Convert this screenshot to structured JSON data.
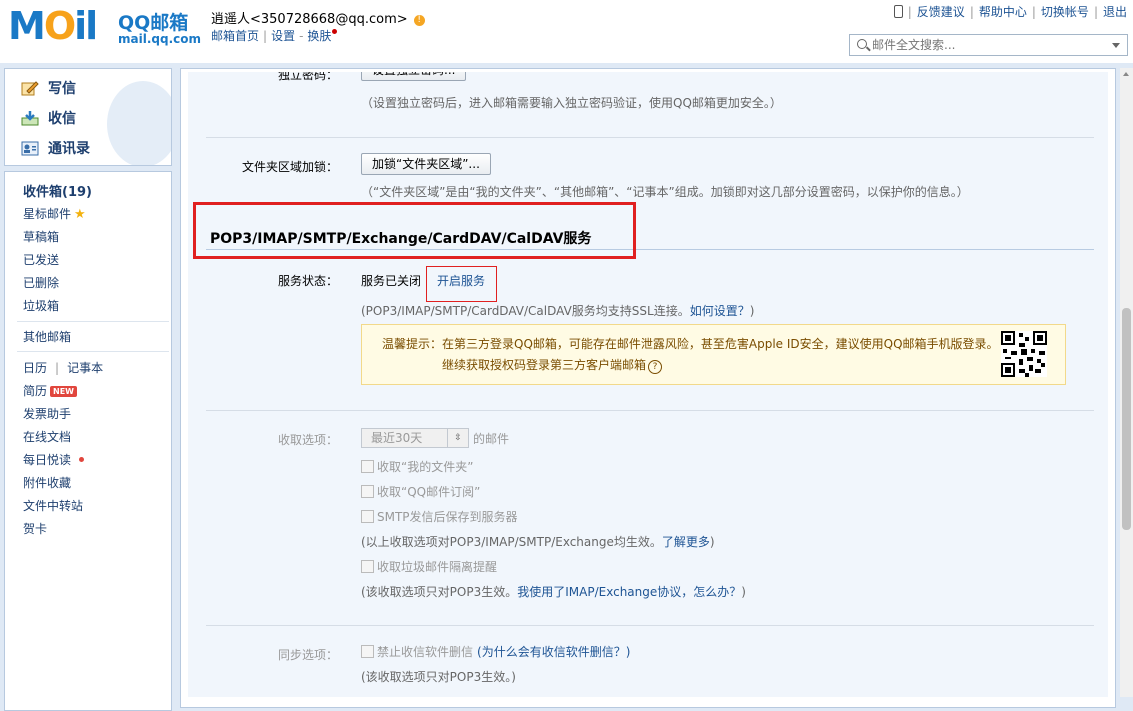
{
  "header": {
    "logo_text": "MOil",
    "logo_brand": "QQ邮箱",
    "logo_domain": "mail.qq.com",
    "user_display": "逍遥人<350728668@qq.com>",
    "nav": {
      "home": "邮箱首页",
      "settings": "设置",
      "skin": "换肤"
    },
    "topnav": {
      "feedback": "反馈建议",
      "help": "帮助中心",
      "switch": "切换帐号",
      "logout": "退出"
    },
    "search_placeholder": "邮件全文搜索..."
  },
  "sidebar": {
    "quick": {
      "compose": "写信",
      "receive": "收信",
      "contacts": "通讯录"
    },
    "folders": {
      "inbox": "收件箱(19)",
      "starred": "星标邮件",
      "drafts": "草稿箱",
      "sent": "已发送",
      "deleted": "已删除",
      "spam": "垃圾箱",
      "other": "其他邮箱"
    },
    "tools": {
      "calendar": "日历",
      "notes": "记事本",
      "resume": "简历",
      "new_badge": "NEW",
      "invoice": "发票助手",
      "docs": "在线文档",
      "daily": "每日悦读",
      "attachments": "附件收藏",
      "transfer": "文件中转站",
      "cards": "贺卡"
    }
  },
  "content": {
    "indep_pwd": {
      "label": "独立密码：",
      "button": "设置独立密码...",
      "hint": "（设置独立密码后，进入邮箱需要输入独立密码验证，使用QQ邮箱更加安全。）"
    },
    "folder_lock": {
      "label": "文件夹区域加锁：",
      "button": "加锁“文件夹区域”...",
      "hint": "（“文件夹区域”是由“我的文件夹”、“其他邮箱”、“记事本”组成。加锁即对这几部分设置密码，以保护你的信息。）"
    },
    "section_title": "POP3/IMAP/SMTP/Exchange/CardDAV/CalDAV服务",
    "service_status": {
      "label": "服务状态：",
      "value": "服务已关闭",
      "action": "开启服务"
    },
    "ssl_hint": "(POP3/IMAP/SMTP/CardDAV/CalDAV服务均支持SSL连接。",
    "ssl_link": "如何设置？",
    "ssl_close": ")",
    "tip": {
      "line1": "温馨提示：在第三方登录QQ邮箱，可能存在邮件泄露风险，甚至危害Apple ID安全，建议使用QQ邮箱手机版登录。",
      "line2": "继续获取授权码登录第三方客户端邮箱",
      "qmark": "?"
    },
    "receive": {
      "label": "收取选项：",
      "select_value": "最近30天",
      "suffix": "的邮件",
      "opt1": "收取“我的文件夹”",
      "opt2": "收取“QQ邮件订阅”",
      "opt3": "SMTP发信后保存到服务器",
      "note1": "(以上收取选项对POP3/IMAP/SMTP/Exchange均生效。",
      "note1_link": "了解更多",
      "note1_close": ")",
      "opt4": "收取垃圾邮件隔离提醒",
      "note2": "(该收取选项只对POP3生效。",
      "note2_link": "我使用了IMAP/Exchange协议，怎么办？",
      "note2_close": ")"
    },
    "sync": {
      "label": "同步选项：",
      "opt": "禁止收信软件删信",
      "link": "(为什么会有收信软件删信？)",
      "note": "(该收取选项只对POP3生效。)"
    }
  },
  "colors": {
    "highlight_red": "#e02020",
    "link_blue": "#1e5494",
    "tip_bg": "#fffbe4"
  }
}
